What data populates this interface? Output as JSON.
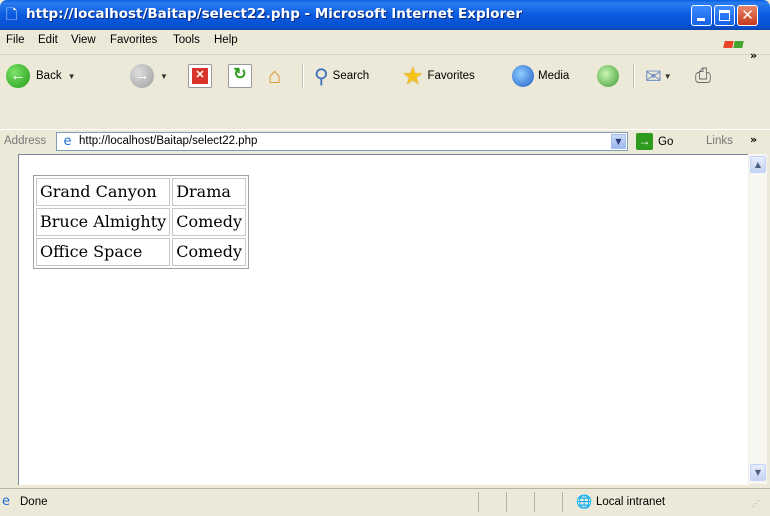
{
  "window": {
    "title": "http://localhost/Baitap/select22.php - Microsoft Internet Explorer",
    "title_icon": "ie-page-icon"
  },
  "menu": {
    "items": [
      "File",
      "Edit",
      "View",
      "Favorites",
      "Tools",
      "Help"
    ]
  },
  "toolbar": {
    "back_label": "Back",
    "search_label": "Search",
    "favorites_label": "Favorites",
    "media_label": "Media"
  },
  "address": {
    "label": "Address",
    "value": "http://localhost/Baitap/select22.php",
    "go_label": "Go",
    "links_label": "Links"
  },
  "content": {
    "rows": [
      [
        "Grand Canyon",
        "Drama"
      ],
      [
        "Bruce Almighty",
        "Comedy"
      ],
      [
        "Office Space",
        "Comedy"
      ]
    ]
  },
  "status": {
    "text": "Done",
    "zone": "Local intranet"
  },
  "colors": {
    "titlebar": "#0b5be0",
    "chrome": "#ece9d8",
    "close_button": "#c7391c"
  }
}
